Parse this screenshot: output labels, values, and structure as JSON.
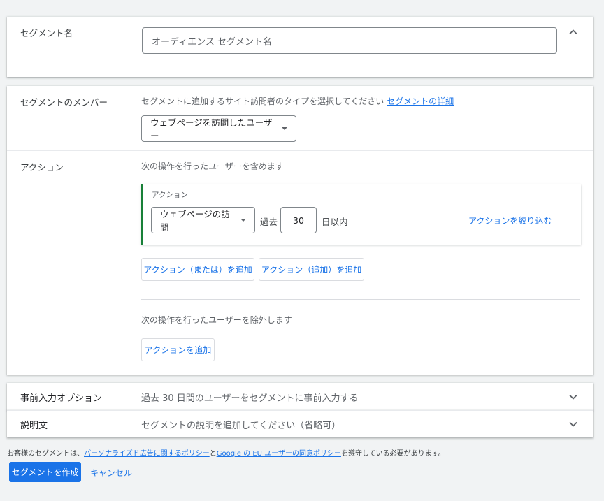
{
  "segment_name": {
    "label": "セグメント名",
    "placeholder": "オーディエンス セグメント名"
  },
  "members": {
    "label": "セグメントのメンバー",
    "description": "セグメントに追加するサイト訪問者のタイプを選択してください",
    "details_link": "セグメントの詳細",
    "dropdown_value": "ウェブページを訪問したユーザー"
  },
  "actions": {
    "label": "アクション",
    "include_text": "次の操作を行ったユーザーを含めます",
    "action_box": {
      "title": "アクション",
      "dropdown_value": "ウェブページの訪問",
      "past_label": "過去",
      "days_value": "30",
      "days_suffix": "日以内",
      "refine_link": "アクションを絞り込む"
    },
    "add_or_button": "アクション（または）を追加",
    "add_and_button": "アクション（追加）を追加",
    "exclude_text": "次の操作を行ったユーザーを除外します",
    "add_button": "アクションを追加"
  },
  "prefill": {
    "label": "事前入力オプション",
    "value": "過去 30 日間のユーザーをセグメントに事前入力する"
  },
  "description": {
    "label": "説明文",
    "placeholder": "セグメントの説明を追加してください（省略可）"
  },
  "footer": {
    "policy_prefix": "お客様のセグメントは、",
    "policy_link1": "パーソナライズド広告に関するポリシー",
    "policy_mid": "と",
    "policy_link2": "Google の EU ユーザーの同意ポリシー",
    "policy_suffix": "を遵守している必要があります。",
    "create_button": "セグメントを作成",
    "cancel_button": "キャンセル"
  },
  "colors": {
    "accent": "#1a73e8",
    "green_bar": "#188038",
    "background": "#f1f3f4"
  }
}
